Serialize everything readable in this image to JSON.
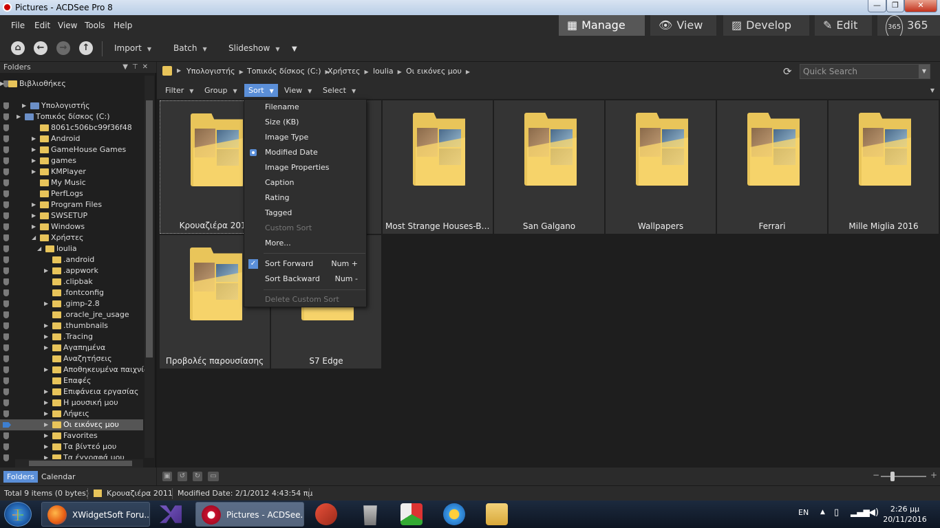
{
  "window": {
    "title": "Pictures - ACDSee Pro 8",
    "minimize": "—",
    "maximize": "❐",
    "close": "✕"
  },
  "menu": {
    "items": [
      "File",
      "Edit",
      "View",
      "Tools",
      "Help"
    ]
  },
  "modes": [
    {
      "label": "Manage",
      "icon": "▦"
    },
    {
      "label": "View",
      "icon": "👁"
    },
    {
      "label": "Develop",
      "icon": "▨"
    },
    {
      "label": "Edit",
      "icon": "✎"
    },
    {
      "label": "365",
      "icon": "365"
    }
  ],
  "toolbar": {
    "import": "Import",
    "batch": "Batch",
    "slideshow": "Slideshow"
  },
  "folders_panel": {
    "title": "Folders",
    "rows": [
      {
        "label": "Βιβλιοθήκες"
      },
      {
        "label": "Υπολογιστής"
      },
      {
        "label": "Τοπικός δίσκος (C:)"
      },
      {
        "label": "8061c506bc99f36f48"
      },
      {
        "label": "Android"
      },
      {
        "label": "GameHouse Games"
      },
      {
        "label": "games"
      },
      {
        "label": "KMPlayer"
      },
      {
        "label": "My Music"
      },
      {
        "label": "PerfLogs"
      },
      {
        "label": "Program Files"
      },
      {
        "label": "SWSETUP"
      },
      {
        "label": "Windows"
      },
      {
        "label": "Χρήστες"
      },
      {
        "label": "loulia"
      },
      {
        "label": ".android"
      },
      {
        "label": ".appwork"
      },
      {
        "label": ".clipbak"
      },
      {
        "label": ".fontconfig"
      },
      {
        "label": ".gimp-2.8"
      },
      {
        "label": ".oracle_jre_usage"
      },
      {
        "label": ".thumbnails"
      },
      {
        "label": ".Tracing"
      },
      {
        "label": "Αγαπημένα"
      },
      {
        "label": "Αναζητήσεις"
      },
      {
        "label": "Αποθηκευμένα παιχνίδ"
      },
      {
        "label": "Επαφές"
      },
      {
        "label": "Επιφάνεια εργασίας"
      },
      {
        "label": "Η μουσική μου"
      },
      {
        "label": "Λήψεις"
      },
      {
        "label": "Οι εικόνες μου"
      },
      {
        "label": "Favorites"
      },
      {
        "label": "Τα βίντεό μου"
      },
      {
        "label": "Τα έγγραφά μου"
      }
    ],
    "tabs": [
      "Folders",
      "Calendar"
    ]
  },
  "breadcrumb": [
    "Υπολογιστής",
    "Τοπικός δίσκος (C:)",
    "Χρήστες",
    "loulia",
    "Οι εικόνες μου"
  ],
  "search": {
    "placeholder": "Quick Search"
  },
  "filterbar": [
    "Filter",
    "Group",
    "Sort",
    "View",
    "Select"
  ],
  "tiles": [
    "Κρουαζιέρα 2011",
    "",
    "Most Strange Houses-Buildi...",
    "San Galgano",
    "Wallpapers",
    "Ferrari",
    "Mille Miglia 2016",
    "Προβολές παρουσίασης",
    "S7 Edge"
  ],
  "sort_menu": {
    "items": [
      "Filename",
      "Size (KB)",
      "Image Type",
      "Modified Date",
      "Image Properties",
      "Caption",
      "Rating",
      "Tagged",
      "Custom Sort",
      "More..."
    ],
    "selected": "Modified Date",
    "sort_forward": "Sort Forward",
    "sort_forward_key": "Num +",
    "sort_backward": "Sort Backward",
    "sort_backward_key": "Num -",
    "delete_custom": "Delete Custom Sort"
  },
  "status": {
    "total": "Total 9 items  (0 bytes)",
    "current": "Κρουαζιέρα 2011",
    "modified": "Modified Date: 2/1/2012 4:43:54 πμ"
  },
  "taskbar": {
    "tasks": [
      "XWidgetSoft Foru...",
      "Pictures - ACDSee..."
    ],
    "lang": "EN",
    "time": "2:26 μμ",
    "date": "20/11/2016"
  },
  "colors": {
    "accent": "#5b8fd8",
    "folder": "#e9c55a",
    "panel": "#2b2b2b"
  }
}
